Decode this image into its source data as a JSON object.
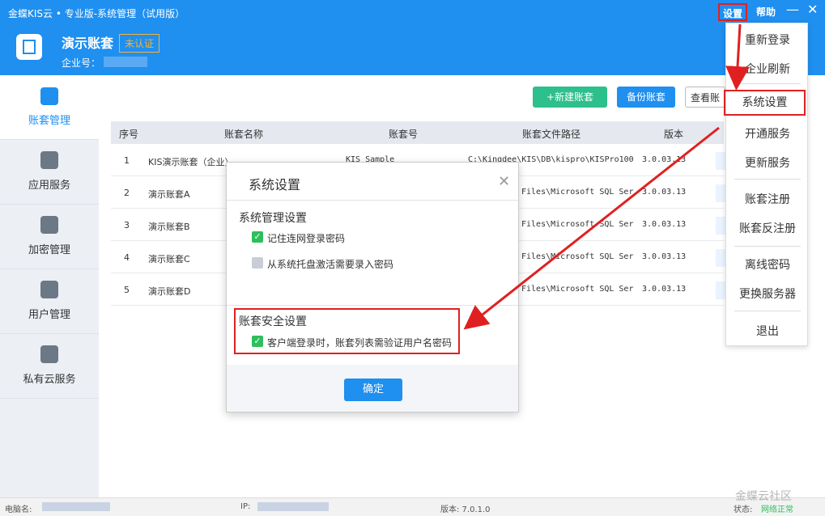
{
  "header": {
    "title": "金蝶KIS云 • 专业版-系统管理（试用版）",
    "account_name": "演示账套",
    "badge": "未认证",
    "enterprise_label": "企业号：",
    "settings_label": "设置",
    "help_label": "帮助",
    "minimize": "—",
    "close": "✕"
  },
  "sidebar": {
    "items": [
      {
        "label": "账套管理",
        "icon": "clipboard-icon"
      },
      {
        "label": "应用服务",
        "icon": "apps-icon"
      },
      {
        "label": "加密管理",
        "icon": "lock-icon"
      },
      {
        "label": "用户管理",
        "icon": "user-icon"
      },
      {
        "label": "私有云服务",
        "icon": "cloud-monitor-icon"
      }
    ]
  },
  "toolbar": {
    "new_label": "+新建账套",
    "backup_label": "备份账套",
    "view_label": "查看账"
  },
  "table": {
    "headers": [
      "序号",
      "账套名称",
      "账套号",
      "账套文件路径",
      "版本"
    ],
    "rows": [
      {
        "no": "1",
        "name": "KIS演示账套（企业）",
        "code": "KIS Sample",
        "path": "C:\\Kingdee\\KIS\\DB\\kispro\\KISPro100",
        "version": "3.0.03.13"
      },
      {
        "no": "2",
        "name": "演示账套A",
        "code": "",
        "path": "Files\\Microsoft SQL Ser",
        "version": "3.0.03.13"
      },
      {
        "no": "3",
        "name": "演示账套B",
        "code": "",
        "path": "Files\\Microsoft SQL Ser",
        "version": "3.0.03.13"
      },
      {
        "no": "4",
        "name": "演示账套C",
        "code": "",
        "path": "Files\\Microsoft SQL Ser",
        "version": "3.0.03.13"
      },
      {
        "no": "5",
        "name": "演示账套D",
        "code": "",
        "path": "Files\\Microsoft SQL Ser",
        "version": "3.0.03.13"
      }
    ]
  },
  "menu": {
    "items": [
      "重新登录",
      "企业刷新",
      "系统设置",
      "开通服务",
      "更新服务",
      "账套注册",
      "账套反注册",
      "离线密码",
      "更换服务器",
      "退出"
    ]
  },
  "dialog": {
    "title": "系统设置",
    "close": "✕",
    "section1": "系统管理设置",
    "opt1": "记住连网登录密码",
    "opt2": "从系统托盘激活需要录入密码",
    "section2": "账套安全设置",
    "opt3": "客户端登录时，账套列表需验证用户名密码",
    "ok": "确定",
    "check": "✓"
  },
  "status": {
    "pc_label": "电脑名:",
    "ip_label": "IP:",
    "version": "版本: 7.0.1.0",
    "state_label": "状态:",
    "state_value": "网络正常",
    "brand": "金蝶云社区"
  },
  "colors": {
    "primary": "#1f8ff0",
    "green": "#2dbf8c",
    "annotation_red": "#e02020"
  }
}
